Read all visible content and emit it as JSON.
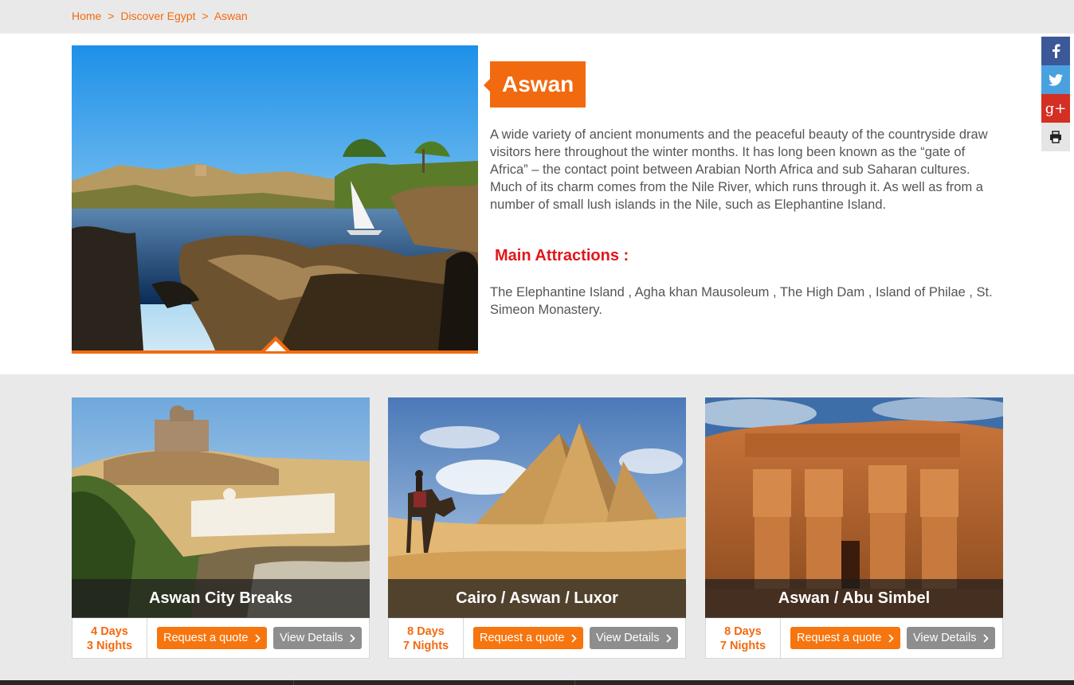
{
  "breadcrumb": {
    "items": [
      "Home",
      "Discover Egypt",
      "Aswan"
    ],
    "separator": ">"
  },
  "destination": {
    "title": "Aswan",
    "description": "A wide variety of ancient monuments and the peaceful beauty of the countryside draw visitors here throughout the winter months. It has long been known as the “gate of Africa” – the contact point between Arabian North Africa and sub Saharan cultures. Much of its charm comes from the Nile River, which runs through it. As well as from a number of small lush islands in the Nile, such as Elephantine Island.",
    "attractions_title": "Main Attractions :",
    "attractions_text": "The Elephantine Island , Agha khan Mausoleum , The High Dam , Island of Philae , St. Simeon Monastery."
  },
  "social": [
    "facebook-icon",
    "twitter-icon",
    "google-plus-icon",
    "print-icon"
  ],
  "tours": [
    {
      "name": "Aswan City Breaks",
      "days": "4 Days",
      "nights": "3 Nights",
      "quote_label": "Request a quote",
      "view_label": "View Details"
    },
    {
      "name": "Cairo / Aswan / Luxor",
      "days": "8 Days",
      "nights": "7 Nights",
      "quote_label": "Request a quote",
      "view_label": "View Details"
    },
    {
      "name": "Aswan / Abu Simbel",
      "days": "8 Days",
      "nights": "7 Nights",
      "quote_label": "Request a quote",
      "view_label": "View Details"
    }
  ],
  "colors": {
    "accent": "#f26a0f",
    "attraction_title": "#e3161b",
    "view_button": "#8e8e8e",
    "text": "#555555"
  }
}
